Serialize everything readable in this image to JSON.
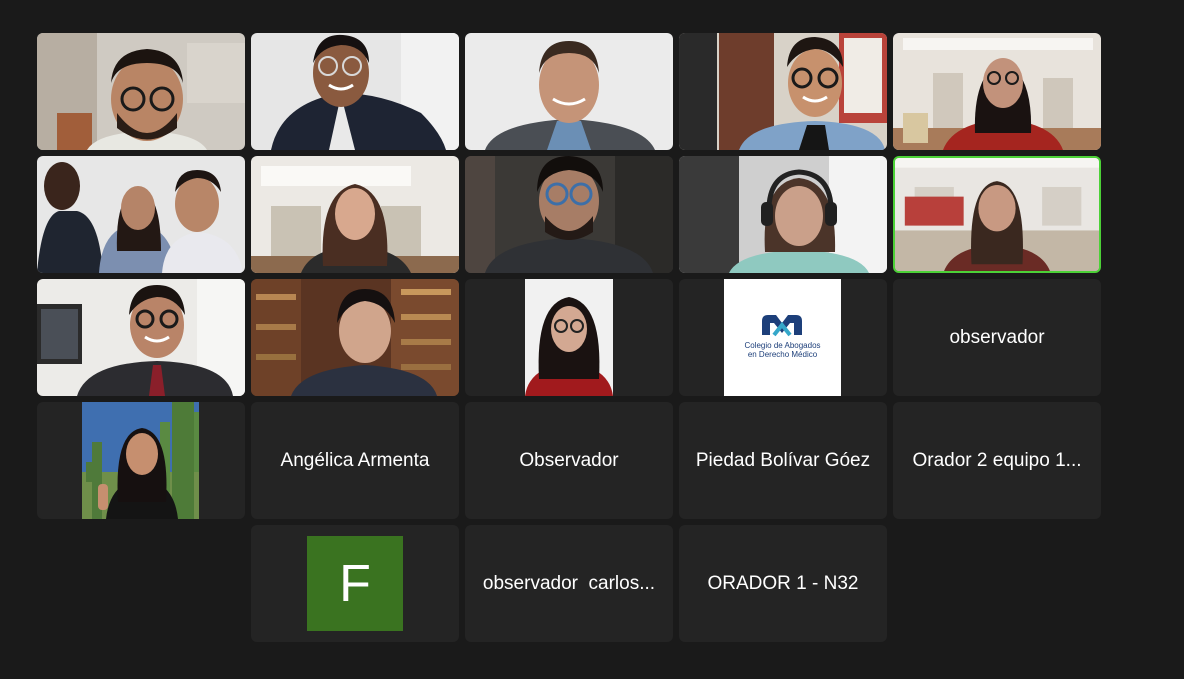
{
  "meeting": {
    "participants": [
      {
        "id": "p1",
        "type": "video"
      },
      {
        "id": "p2",
        "type": "video"
      },
      {
        "id": "p3",
        "type": "video"
      },
      {
        "id": "p4",
        "type": "video"
      },
      {
        "id": "p5",
        "type": "video"
      },
      {
        "id": "p6",
        "type": "video"
      },
      {
        "id": "p7",
        "type": "video"
      },
      {
        "id": "p8",
        "type": "video"
      },
      {
        "id": "p9",
        "type": "video"
      },
      {
        "id": "p10",
        "type": "video",
        "speaking": true
      },
      {
        "id": "p11",
        "type": "video"
      },
      {
        "id": "p12",
        "type": "video"
      },
      {
        "id": "p13",
        "type": "profile-picture"
      },
      {
        "id": "p14",
        "type": "profile-logo"
      },
      {
        "id": "p15",
        "type": "name",
        "name": "observador"
      },
      {
        "id": "p16",
        "type": "profile-picture"
      },
      {
        "id": "p17",
        "type": "name",
        "name": "Angélica Armenta"
      },
      {
        "id": "p18",
        "type": "name",
        "name": "Observador"
      },
      {
        "id": "p19",
        "type": "name",
        "name": "Piedad Bolívar Góez"
      },
      {
        "id": "p20",
        "type": "name",
        "name": "Orador 2 equipo 1..."
      },
      {
        "id": "p21",
        "type": "avatar-initial",
        "initial": "F"
      },
      {
        "id": "p22",
        "type": "name",
        "name": "observador  carlos..."
      },
      {
        "id": "p23",
        "type": "name",
        "name": "ORADOR 1 - N32"
      }
    ],
    "logo": {
      "line1": "Colegio de Abogados",
      "line2": "en Derecho Médico"
    },
    "colors": {
      "background": "#1a1a1a",
      "tile": "#242424",
      "active_speaker_border": "#4cd137",
      "avatar_green": "#3a7320",
      "logo_blue": "#1d3f7a"
    }
  }
}
